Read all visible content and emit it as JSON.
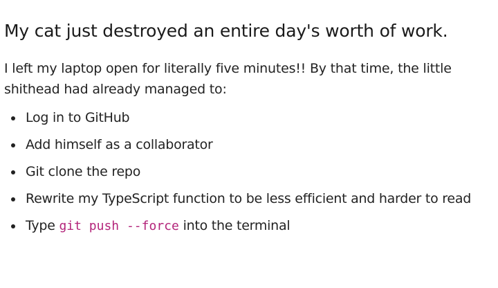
{
  "post": {
    "title": "My cat just destroyed an entire day's worth of work.",
    "intro_line1": "I left my laptop open for literally five minutes!! By that time, the little",
    "intro_line2": "shithead had already managed to:",
    "items": [
      {
        "text": "Log in to GitHub"
      },
      {
        "text": "Add himself as a collaborator"
      },
      {
        "text": "Git clone the repo"
      },
      {
        "text": "Rewrite my TypeScript function to be less efficient and harder to read"
      },
      {
        "prefix": "Type ",
        "code": "git push --force",
        "suffix": " into the terminal"
      }
    ],
    "code_color": "#b3247a"
  }
}
